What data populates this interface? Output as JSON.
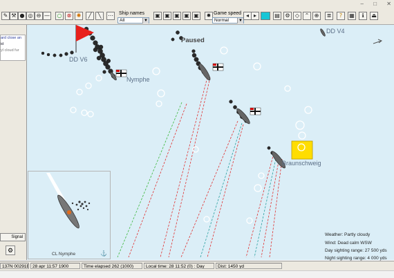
{
  "window": {
    "title_controls": [
      "–",
      "□",
      "✕"
    ]
  },
  "toolbar": {
    "ship_names_label": "Ship names",
    "ship_names_value": "All",
    "game_speed_label": "Game speed",
    "game_speed_value": "Normal"
  },
  "left_panel": {
    "line1": "ard close an",
    "line2": "id",
    "line3": "yl cloud fur",
    "button_label": "Signal"
  },
  "map": {
    "paused_label": "Paused",
    "ships": {
      "dd_v6": "DD V6",
      "dd_v4": "DD V4",
      "nymphe": "Nymphe",
      "braunschweig": "Braunschweig"
    },
    "inset_label": "CL Nymphe",
    "weather": {
      "weather": "Weather: Partly cloudy",
      "wind": "Wind: Dead calm  WSW",
      "day_range": "Day sighting range: 27 500 yds",
      "night_range": "Night sighting range: 4 000 yds"
    },
    "colors": {
      "sea": "#dbeef7",
      "marker_yellow": "#ffdd00",
      "flag_red": "#e8201c"
    }
  },
  "status_bar": {
    "position": "137N 00291E",
    "date": "28 apr 11:57 1900",
    "time_elapsed": "Time elapsed 262 (1000)",
    "local_time": "Local time: 28 11:52 (0) : Day",
    "distance": "Dist: 1450 yd"
  }
}
